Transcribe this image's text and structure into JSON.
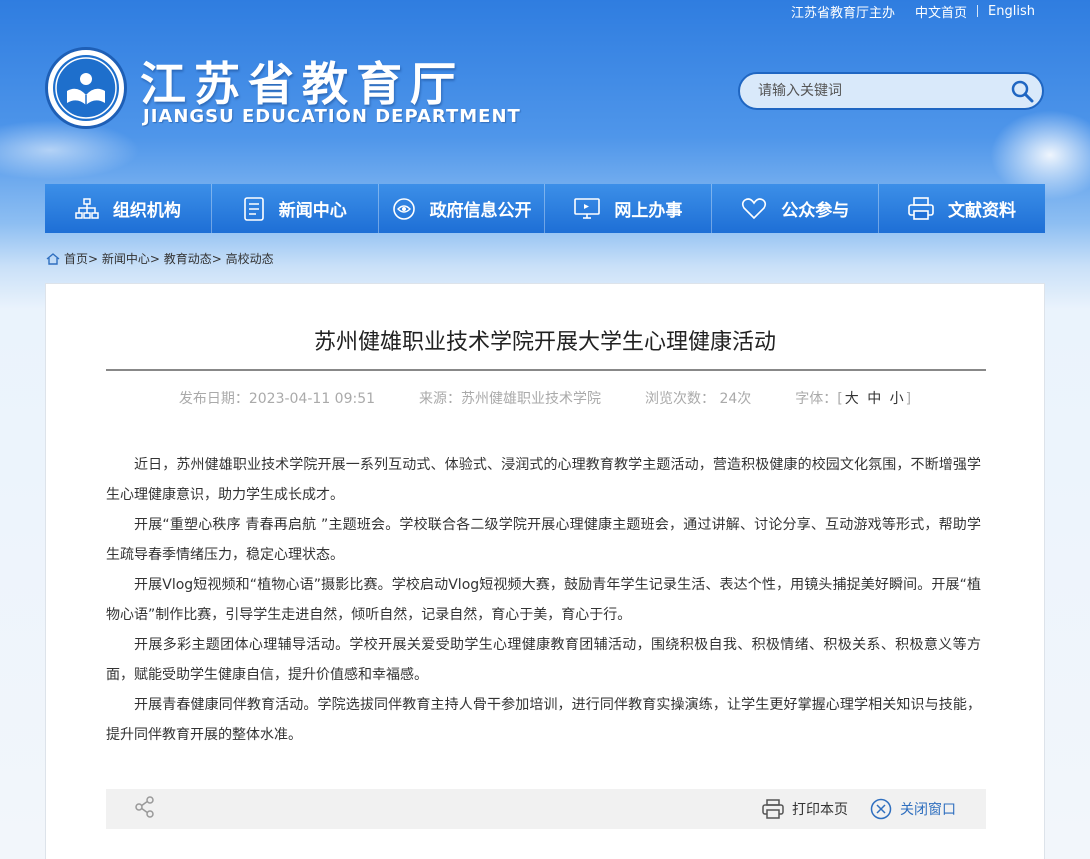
{
  "header": {
    "top_links": [
      "江苏省教育厅主办",
      "中文首页",
      "English"
    ],
    "site_name_cn": "江苏省教育厅",
    "site_name_en": "JIANGSU EDUCATION DEPARTMENT",
    "search_placeholder": "请输入关键词"
  },
  "nav": {
    "items": [
      {
        "label": "组织机构",
        "icon": "org-chart-icon"
      },
      {
        "label": "新闻中心",
        "icon": "document-icon"
      },
      {
        "label": "政府信息公开",
        "icon": "eye-icon"
      },
      {
        "label": "网上办事",
        "icon": "monitor-icon"
      },
      {
        "label": "公众参与",
        "icon": "heart-icon"
      },
      {
        "label": "文献资料",
        "icon": "printer-icon"
      }
    ]
  },
  "breadcrumb": [
    "首页",
    "新闻中心",
    "教育动态",
    "高校动态"
  ],
  "article": {
    "title": "苏州健雄职业技术学院开展大学生心理健康活动",
    "date": "发布日期：2023-04-11 09:51",
    "source": "来源：苏州健雄职业技术学院",
    "views": "浏览次数： 24次",
    "font_label": "字体：",
    "font_sizes": [
      "大",
      "中",
      "小"
    ],
    "paragraphs": [
      "近日，苏州健雄职业技术学院开展一系列互动式、体验式、浸润式的心理教育教学主题活动，营造积极健康的校园文化氛围，不断增强学生心理健康意识，助力学生成长成才。",
      "开展“重塑心秩序 青春再启航 ”主题班会。学校联合各二级学院开展心理健康主题班会，通过讲解、讨论分享、互动游戏等形式，帮助学生疏导春季情绪压力，稳定心理状态。",
      "开展Vlog短视频和“植物心语”摄影比赛。学校启动Vlog短视频大赛，鼓励青年学生记录生活、表达个性，用镜头捕捉美好瞬间。开展“植物心语”制作比赛，引导学生走进自然，倾听自然，记录自然，育心于美，育心于行。",
      "开展多彩主题团体心理辅导活动。学校开展关爱受助学生心理健康教育团辅活动，围绕积极自我、积极情绪、积极关系、积极意义等方面，赋能受助学生健康自信，提升价值感和幸福感。",
      "开展青春健康同伴教育活动。学院选拔同伴教育主持人骨干参加培训，进行同伴教育实操演练，让学生更好掌握心理学相关知识与技能，提升同伴教育开展的整体水准。"
    ]
  },
  "toolbar": {
    "print_label": "打印本页",
    "close_label": "关闭窗口"
  },
  "colors": {
    "nav_blue": "#1e6fd6",
    "close_link": "#2f6fbf"
  }
}
